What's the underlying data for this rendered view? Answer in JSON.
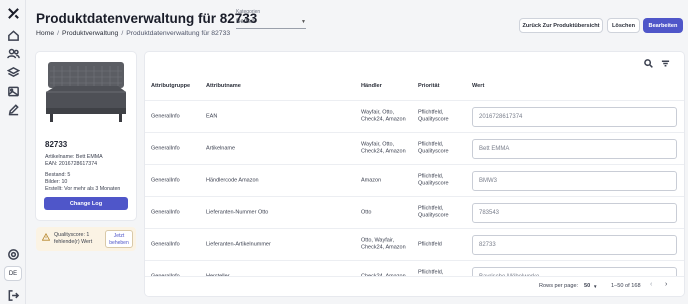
{
  "sidebar": {
    "items": [
      {
        "icon": "logo-icon"
      },
      {
        "icon": "home-icon"
      },
      {
        "icon": "users-icon"
      },
      {
        "icon": "layers-icon"
      },
      {
        "icon": "image-icon"
      },
      {
        "icon": "edit-icon"
      },
      {
        "icon": "settings-icon"
      }
    ],
    "language": "DE",
    "logout_icon": "logout-icon"
  },
  "header": {
    "title": "Produktdatenverwaltung für 82733",
    "category_label": "Kategorien",
    "category_value": "Betten",
    "breadcrumb": [
      "Home",
      "Produktverwaltung",
      "Produktdatenverwaltung für 82733"
    ],
    "buttons": {
      "back": "Zurück Zur Produktübersicht",
      "delete": "Löschen",
      "edit": "Bearbeiten"
    }
  },
  "product": {
    "id": "82733",
    "article_name": "Artikelname: Bett EMMA",
    "ean": "EAN: 2016728617374",
    "stock": "Bestand: 5",
    "images": "Bilder: 10",
    "created": "Erstellt: Vor mehr als 3 Monaten",
    "change_log": "Change Log"
  },
  "quality": {
    "text": "Qualityscore: 1 fehlende(r) Wert",
    "fix_button": "Jetzt beheben"
  },
  "table": {
    "columns": [
      "Attributgruppe",
      "Attributname",
      "Händler",
      "Priorität",
      "Wert"
    ],
    "rows": [
      {
        "group": "GeneralInfo",
        "name": "EAN",
        "dealer": "Wayfair, Otto, Check24, Amazon",
        "priority": "Pflichtfeld, Qualityscore",
        "value": "2016728617374"
      },
      {
        "group": "GeneralInfo",
        "name": "Artikelname",
        "dealer": "Wayfair, Otto, Check24, Amazon",
        "priority": "Pflichtfeld, Qualityscore",
        "value": "Bett EMMA"
      },
      {
        "group": "GeneralInfo",
        "name": "Händlercode Amazon",
        "dealer": "Amazon",
        "priority": "Pflichtfeld, Qualityscore",
        "value": "BMW3"
      },
      {
        "group": "GeneralInfo",
        "name": "Lieferanten-Nummer Otto",
        "dealer": "Otto",
        "priority": "Pflichtfeld, Qualityscore",
        "value": "783543"
      },
      {
        "group": "GeneralInfo",
        "name": "Lieferanten-Artikelnummer",
        "dealer": "Otto, Wayfair, Check24, Amazon",
        "priority": "Pflichtfeld",
        "value": "82733"
      },
      {
        "group": "GeneralInfo",
        "name": "Hersteller",
        "dealer": "Check24, Amazon",
        "priority": "Pflichtfeld, Qualityscore",
        "value": "Bayrische Möbelwerke"
      }
    ],
    "footer": {
      "rows_per_page_label": "Rows per page:",
      "rows_per_page": "50",
      "range": "1–50 of 168"
    }
  },
  "colors": {
    "accent": "#4f56c9",
    "warning_bg": "#fbf3e4"
  }
}
